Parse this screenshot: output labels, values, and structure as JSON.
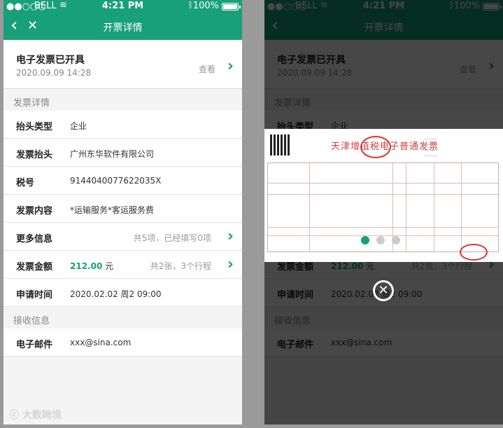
{
  "status_bar": {
    "dots": "●●○○○",
    "carrier": "BELL",
    "time": "4:21 PM",
    "battery": "100%"
  },
  "nav": {
    "title": "开票详情"
  },
  "invoice_status": {
    "title": "电子发票已开具",
    "datetime": "2020.09.09 14:28",
    "view_label": "查看"
  },
  "sections": {
    "invoice_details": "发票详情",
    "receive_info": "接收信息"
  },
  "rows": {
    "header_type": {
      "label": "抬头类型",
      "value": "企业"
    },
    "invoice_header": {
      "label": "发票抬头",
      "value": "广州东华软件有限公司"
    },
    "tax_id": {
      "label": "税号",
      "value": "9144040077622035X"
    },
    "content": {
      "label": "发票内容",
      "value": "*运输服务*客运服务费"
    },
    "more_info": {
      "label": "更多信息",
      "hint": "共5项，已经填写0项"
    },
    "amount": {
      "label": "发票金额",
      "value": "212.00",
      "unit": "元",
      "hint": "共2张，3个行程"
    },
    "apply_time": {
      "label": "申请时间",
      "value": "2020.02.02  周2 09:00"
    },
    "email": {
      "label": "电子邮件",
      "value": "xxx@sina.com"
    }
  },
  "watermark": "大数跨境",
  "invoice_preview": {
    "title": "天津增值税电子普通发票",
    "page_count": 3,
    "active_page": 1
  },
  "colors": {
    "brand": "#18a078",
    "background": "#f4f4f4"
  }
}
